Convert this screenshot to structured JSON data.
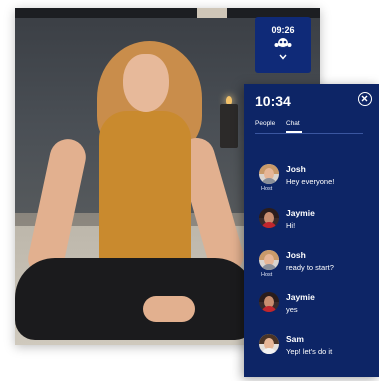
{
  "video": {
    "timer_widget": {
      "time": "09:26",
      "icon": "people-icon",
      "chevron_icon": "chevron-down-icon"
    }
  },
  "chat_panel": {
    "time": "10:34",
    "close_icon": "close-circle-icon",
    "tabs": [
      {
        "label": "People",
        "active": false
      },
      {
        "label": "Chat",
        "active": true
      }
    ],
    "messages": [
      {
        "name": "Josh",
        "text": "Hey everyone!",
        "tag": "Host",
        "avatar": "josh"
      },
      {
        "name": "Jaymie",
        "text": "Hi!",
        "tag": "",
        "avatar": "jaymie"
      },
      {
        "name": "Josh",
        "text": "ready to start?",
        "tag": "Host",
        "avatar": "josh"
      },
      {
        "name": "Jaymie",
        "text": "yes",
        "tag": "",
        "avatar": "jaymie"
      },
      {
        "name": "Sam",
        "text": "Yep! let's do it",
        "tag": "",
        "avatar": "sam"
      }
    ]
  },
  "colors": {
    "panel_bg": "#0d2566",
    "timer_bg": "#0f2a78",
    "text": "#ffffff"
  }
}
